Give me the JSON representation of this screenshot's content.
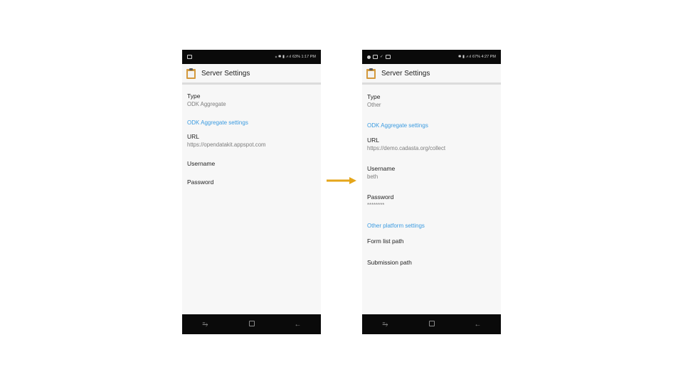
{
  "left_phone": {
    "status": {
      "text": "63% 1:17 PM"
    },
    "app_bar": {
      "title": "Server Settings"
    },
    "prefs": {
      "type": {
        "title": "Type",
        "summary": "ODK Aggregate"
      },
      "category": "ODK Aggregate settings",
      "url": {
        "title": "URL",
        "summary": "https://opendatakit.appspot.com"
      },
      "username": {
        "title": "Username"
      },
      "password": {
        "title": "Password"
      }
    }
  },
  "right_phone": {
    "status": {
      "text": "67% 4:27 PM"
    },
    "app_bar": {
      "title": "Server Settings"
    },
    "prefs": {
      "type": {
        "title": "Type",
        "summary": "Other"
      },
      "category": "ODK Aggregate settings",
      "url": {
        "title": "URL",
        "summary": "https://demo.cadasta.org/collect"
      },
      "username": {
        "title": "Username",
        "summary": "beth"
      },
      "password": {
        "title": "Password",
        "summary": "********"
      },
      "category2": "Other platform settings",
      "form_list_path": {
        "title": "Form list path"
      },
      "submission_path": {
        "title": "Submission path"
      }
    }
  },
  "colors": {
    "accent": "#3b9be0",
    "arrow": "#e5a61a",
    "bar_dark": "#0a0a0a",
    "app_icon": "#d49a3e"
  },
  "icons": [
    "clipboard-icon",
    "recent-apps-icon",
    "home-icon",
    "back-icon",
    "arrow-right-icon"
  ]
}
